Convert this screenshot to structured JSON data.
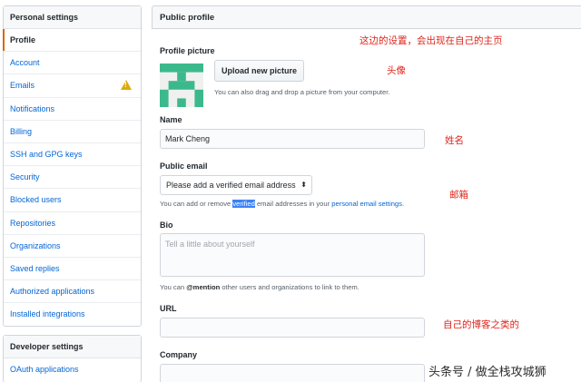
{
  "sidebar": {
    "personal_heading": "Personal settings",
    "items": [
      {
        "label": "Profile"
      },
      {
        "label": "Account"
      },
      {
        "label": "Emails"
      },
      {
        "label": "Notifications"
      },
      {
        "label": "Billing"
      },
      {
        "label": "SSH and GPG keys"
      },
      {
        "label": "Security"
      },
      {
        "label": "Blocked users"
      },
      {
        "label": "Repositories"
      },
      {
        "label": "Organizations"
      },
      {
        "label": "Saved replies"
      },
      {
        "label": "Authorized applications"
      },
      {
        "label": "Installed integrations"
      }
    ],
    "developer_heading": "Developer settings",
    "dev_items": [
      {
        "label": "OAuth applications"
      }
    ]
  },
  "main": {
    "title": "Public profile",
    "picture_label": "Profile picture",
    "upload_button": "Upload new picture",
    "upload_note": "You can also drag and drop a picture from your computer.",
    "name_label": "Name",
    "name_value": "Mark Cheng",
    "email_label": "Public email",
    "email_select": "Please add a verified email address",
    "email_note_1": "You can add or remove ",
    "email_note_hl": "verified",
    "email_note_2": " email addresses in your ",
    "email_note_link": "personal email settings",
    "email_note_3": ".",
    "bio_label": "Bio",
    "bio_placeholder": "Tell a little about yourself",
    "bio_note_1": "You can ",
    "bio_note_mention": "@mention",
    "bio_note_2": " other users and organizations to link to them.",
    "url_label": "URL",
    "company_label": "Company"
  },
  "annotations": {
    "settings_note": "这边的设置，会出现在自己的主页",
    "avatar_note": "头像",
    "name_note": "姓名",
    "email_note": "邮箱",
    "blog_note": "自己的博客之类的",
    "watermark": "头条号 / 做全栈攻城狮"
  },
  "colors": {
    "link": "#0366d6",
    "accent": "#e36209",
    "annotation": "#e0241b",
    "avatar": "#3cb98c"
  }
}
